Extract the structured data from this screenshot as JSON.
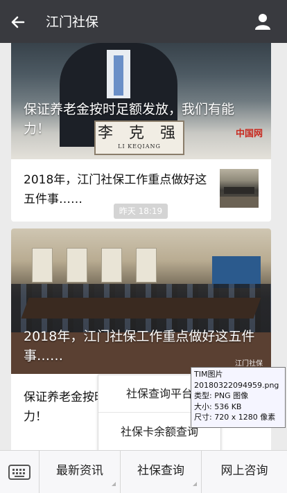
{
  "header": {
    "title": "江门社保",
    "back_icon": "back-arrow-icon",
    "user_icon": "user-profile-icon",
    "bg_color": "#393a3f"
  },
  "feed": {
    "card1": {
      "hero_caption": "保证养老金按时足额发放，我们有能力！",
      "hero_nameplate": "李 克 强",
      "hero_nameplate_sub": "LI KEQIANG",
      "hero_logo": "中国网",
      "article_title": "2018年，江门社保工作重点做好这五件事……"
    },
    "timestamp": "昨天 18:19",
    "card2": {
      "hero_caption": "2018年，江门社保工作重点做好这五件事……",
      "watermark": "江门社保",
      "article_title": "保证养老金按时足额发放，我们有能力！"
    }
  },
  "popup_menu": {
    "items": [
      "社保查询平台",
      "社保卡余额查询"
    ]
  },
  "tooltip": {
    "lines": [
      "TIM图片",
      "20180322094959.png",
      "类型: PNG 图像",
      "大小: 536 KB",
      "尺寸: 720 x 1280 像素"
    ]
  },
  "bottom_menu": {
    "keyboard_icon": "keyboard-icon",
    "tabs": [
      "最新资讯",
      "社保查询",
      "网上咨询"
    ]
  }
}
